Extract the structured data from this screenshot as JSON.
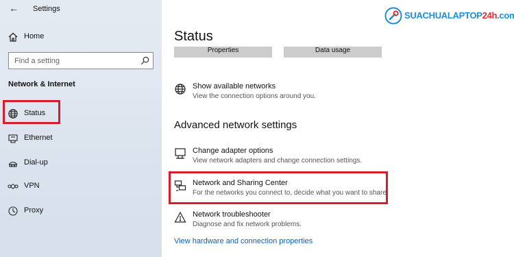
{
  "window": {
    "title": "Settings"
  },
  "sidebar": {
    "home_label": "Home",
    "search_placeholder": "Find a setting",
    "section_title": "Network & Internet",
    "items": [
      {
        "label": "Status",
        "icon": "globe-icon",
        "selected": true
      },
      {
        "label": "Ethernet",
        "icon": "ethernet-icon"
      },
      {
        "label": "Dial-up",
        "icon": "dialup-icon"
      },
      {
        "label": "VPN",
        "icon": "vpn-icon"
      },
      {
        "label": "Proxy",
        "icon": "proxy-icon"
      }
    ]
  },
  "main": {
    "title": "Status",
    "buttons": {
      "properties": "Properties",
      "data_usage": "Data usage"
    },
    "show_networks": {
      "title": "Show available networks",
      "desc": "View the connection options around you."
    },
    "advanced_heading": "Advanced network settings",
    "advanced_items": [
      {
        "title": "Change adapter options",
        "desc": "View network adapters and change connection settings.",
        "icon": "adapter-icon"
      },
      {
        "title": "Network and Sharing Center",
        "desc": "For the networks you connect to, decide what you want to share.",
        "icon": "sharing-center-icon"
      },
      {
        "title": "Network troubleshooter",
        "desc": "Diagnose and fix network problems.",
        "icon": "warning-icon"
      }
    ],
    "hardware_link": "View hardware and connection properties"
  },
  "watermark": {
    "text_main": "SUACHUALAPTOP",
    "text_accent": "24h",
    "text_tail": ".com"
  },
  "colors": {
    "highlight": "#d61e2a",
    "link": "#0b61b5",
    "sidebar_bg": "#e2e8f1",
    "button_bg": "#cccccc"
  }
}
